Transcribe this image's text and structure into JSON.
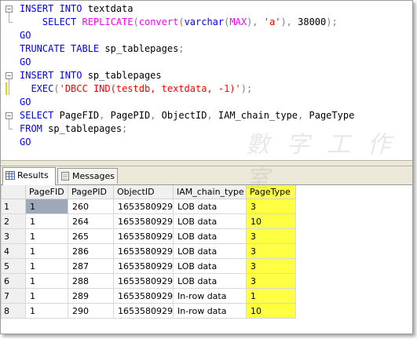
{
  "code": [
    {
      "fold": "box",
      "spans": [
        {
          "c": "k",
          "t": "INSERT INTO "
        },
        {
          "c": "t",
          "t": "textdata"
        }
      ]
    },
    {
      "fold": "end",
      "spans": [
        {
          "c": "t",
          "t": "    "
        },
        {
          "c": "k",
          "t": "SELECT "
        },
        {
          "c": "f",
          "t": "REPLICATE"
        },
        {
          "c": "g",
          "t": "("
        },
        {
          "c": "f",
          "t": "convert"
        },
        {
          "c": "g",
          "t": "("
        },
        {
          "c": "k",
          "t": "varchar"
        },
        {
          "c": "g",
          "t": "("
        },
        {
          "c": "f",
          "t": "MAX"
        },
        {
          "c": "g",
          "t": "), "
        },
        {
          "c": "s",
          "t": "'a'"
        },
        {
          "c": "g",
          "t": "), "
        },
        {
          "c": "t",
          "t": "38000"
        },
        {
          "c": "g",
          "t": ");"
        }
      ]
    },
    {
      "fold": "",
      "spans": [
        {
          "c": "k",
          "t": "GO"
        }
      ]
    },
    {
      "fold": "",
      "spans": [
        {
          "c": "k",
          "t": "TRUNCATE TABLE "
        },
        {
          "c": "t",
          "t": "sp_tablepages"
        },
        {
          "c": "g",
          "t": ";"
        }
      ]
    },
    {
      "fold": "",
      "spans": [
        {
          "c": "k",
          "t": "GO"
        }
      ]
    },
    {
      "fold": "box",
      "spans": [
        {
          "c": "k",
          "t": "INSERT INTO "
        },
        {
          "c": "t",
          "t": "sp_tablepages"
        }
      ]
    },
    {
      "fold": "mark",
      "spans": [
        {
          "c": "t",
          "t": "  "
        },
        {
          "c": "k",
          "t": "EXEC"
        },
        {
          "c": "g",
          "t": "("
        },
        {
          "c": "s",
          "t": "'DBCC IND(testdb, textdata, -1)'"
        },
        {
          "c": "g",
          "t": ");"
        }
      ]
    },
    {
      "fold": "",
      "spans": [
        {
          "c": "k",
          "t": "GO"
        }
      ]
    },
    {
      "fold": "box",
      "spans": [
        {
          "c": "k",
          "t": "SELECT "
        },
        {
          "c": "t",
          "t": "PageFID"
        },
        {
          "c": "g",
          "t": ", "
        },
        {
          "c": "t",
          "t": "PagePID"
        },
        {
          "c": "g",
          "t": ", "
        },
        {
          "c": "t",
          "t": "ObjectID"
        },
        {
          "c": "g",
          "t": ", "
        },
        {
          "c": "t",
          "t": "IAM_chain_type"
        },
        {
          "c": "g",
          "t": ", "
        },
        {
          "c": "t",
          "t": "PageType"
        }
      ]
    },
    {
      "fold": "end",
      "spans": [
        {
          "c": "k",
          "t": "FROM "
        },
        {
          "c": "t",
          "t": "sp_tablepages"
        },
        {
          "c": "g",
          "t": ";"
        }
      ]
    },
    {
      "fold": "",
      "spans": [
        {
          "c": "k",
          "t": "GO"
        }
      ]
    }
  ],
  "colors": {
    "keyword": "#0000ff",
    "function": "#ff00ff",
    "string": "#ff0000",
    "highlight": "#ffff44"
  },
  "tabs": {
    "results": "Results",
    "messages": "Messages"
  },
  "grid": {
    "columns": [
      "PageFID",
      "PagePID",
      "ObjectID",
      "IAM_chain_type",
      "PageType"
    ],
    "rows": [
      [
        "1",
        "1",
        "260",
        "1653580929",
        "LOB data",
        "3"
      ],
      [
        "2",
        "1",
        "264",
        "1653580929",
        "LOB data",
        "10"
      ],
      [
        "3",
        "1",
        "265",
        "1653580929",
        "LOB data",
        "3"
      ],
      [
        "4",
        "1",
        "286",
        "1653580929",
        "LOB data",
        "3"
      ],
      [
        "5",
        "1",
        "287",
        "1653580929",
        "LOB data",
        "3"
      ],
      [
        "6",
        "1",
        "288",
        "1653580929",
        "LOB data",
        "3"
      ],
      [
        "7",
        "1",
        "289",
        "1653580929",
        "In-row data",
        "1"
      ],
      [
        "8",
        "1",
        "290",
        "1653580929",
        "In-row data",
        "10"
      ]
    ]
  }
}
